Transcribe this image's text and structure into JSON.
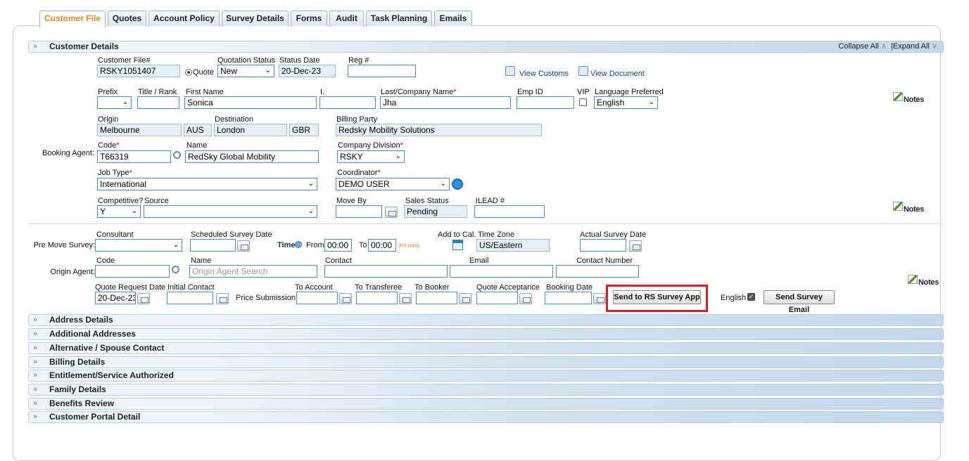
{
  "tabs": [
    "Customer File",
    "Quotes",
    "Account Policy",
    "Survey Details",
    "Forms",
    "Audit",
    "Task Planning",
    "Emails"
  ],
  "section_title": "Customer Details",
  "collapse_all": "Collapse All",
  "expand_all": "Expand All",
  "sep_pipe": "|",
  "view_customs": "View Customs",
  "view_document": "View Document",
  "notes": "Notes",
  "customer_file": {
    "label": "Customer File#",
    "value": "RSKY1051407"
  },
  "quote_radio_label": "Quote",
  "quotation_status": {
    "label": "Quotation Status",
    "value": "New"
  },
  "status_date": {
    "label": "Status Date",
    "value": "20-Dec-23"
  },
  "reg": {
    "label": "Reg #",
    "value": ""
  },
  "prefix": {
    "label": "Prefix",
    "value": ""
  },
  "title_rank": {
    "label": "Title / Rank",
    "value": ""
  },
  "first_name": {
    "label": "First Name",
    "value": "Sonica"
  },
  "initial": {
    "label": "I.",
    "value": ""
  },
  "last_name": {
    "label": "Last/Company Name",
    "value": "Jha"
  },
  "emp_id": {
    "label": "Emp ID",
    "value": ""
  },
  "vip": {
    "label": "VIP",
    "checked": false
  },
  "language": {
    "label": "Language Preferred",
    "value": "English"
  },
  "origin": {
    "label": "Origin",
    "city": "Melbourne",
    "country": "AUS"
  },
  "destination": {
    "label": "Destination",
    "city": "London",
    "country": "GBR"
  },
  "billing_party": {
    "label": "Billing Party",
    "value": "Redsky Mobility Solutions"
  },
  "booking_agent": {
    "label": "Booking Agent:",
    "code_label": "Code",
    "code": "T66319",
    "name_label": "Name",
    "name": "RedSky Global Mobility"
  },
  "company_division": {
    "label": "Company Division",
    "value": "RSKY"
  },
  "job_type": {
    "label": "Job Type",
    "value": "International"
  },
  "coordinator": {
    "label": "Coordinator",
    "value": "DEMO USER"
  },
  "competitive": {
    "label": "Competitive?",
    "value": "Y"
  },
  "source": {
    "label": "Source",
    "value": ""
  },
  "move_by": {
    "label": "Move By",
    "value": ""
  },
  "sales_status": {
    "label": "Sales Status",
    "value": "Pending"
  },
  "ilead": {
    "label": "ILEAD #",
    "value": ""
  },
  "pre_move_survey": {
    "label": "Pre Move Survey:",
    "consultant_label": "Consultant",
    "consultant": ""
  },
  "scheduled_survey_date": {
    "label": "Scheduled Survey Date",
    "value": ""
  },
  "time": {
    "label": "Time",
    "from_label": "From",
    "from": "00:00",
    "to_label": "To",
    "to": "00:00",
    "hint": "(hh:mm)"
  },
  "add_to_cal": "Add to Cal.",
  "time_zone": {
    "label": "Time Zone",
    "value": "US/Eastern"
  },
  "actual_survey_date": {
    "label": "Actual Survey Date",
    "value": ""
  },
  "origin_agent": {
    "label": "Origin Agent:",
    "code_label": "Code",
    "code": "",
    "name_label": "Name",
    "name_placeholder": "Origin Agent Search",
    "contact_label": "Contact",
    "email_label": "Email",
    "contact_number_label": "Contact Number"
  },
  "quote_request_date": {
    "label": "Quote Request Date",
    "value": "20-Dec-23"
  },
  "initial_contact": {
    "label": "Initial Contact",
    "value": ""
  },
  "price_submission": "Price Submission:",
  "to_account": "To Account",
  "to_transferee": "To Transferee",
  "to_booker": "To Booker",
  "quote_acceptance": "Quote Acceptance",
  "booking_date": "Booking Date",
  "send_rs_survey": "Send to RS Survey App",
  "english_label": "English",
  "english_checked": true,
  "send_survey_email": "Send Survey Email",
  "sections": [
    "Address Details",
    "Additional Addresses",
    "Alternative / Spouse Contact",
    "Billing Details",
    "Entitlement/Service Authorized",
    "Family Details",
    "Benefits Review",
    "Customer Portal Detail"
  ],
  "colors": {
    "accent": "#e8861a",
    "highlight": "#e02020",
    "input_border": "#4c90c8"
  }
}
